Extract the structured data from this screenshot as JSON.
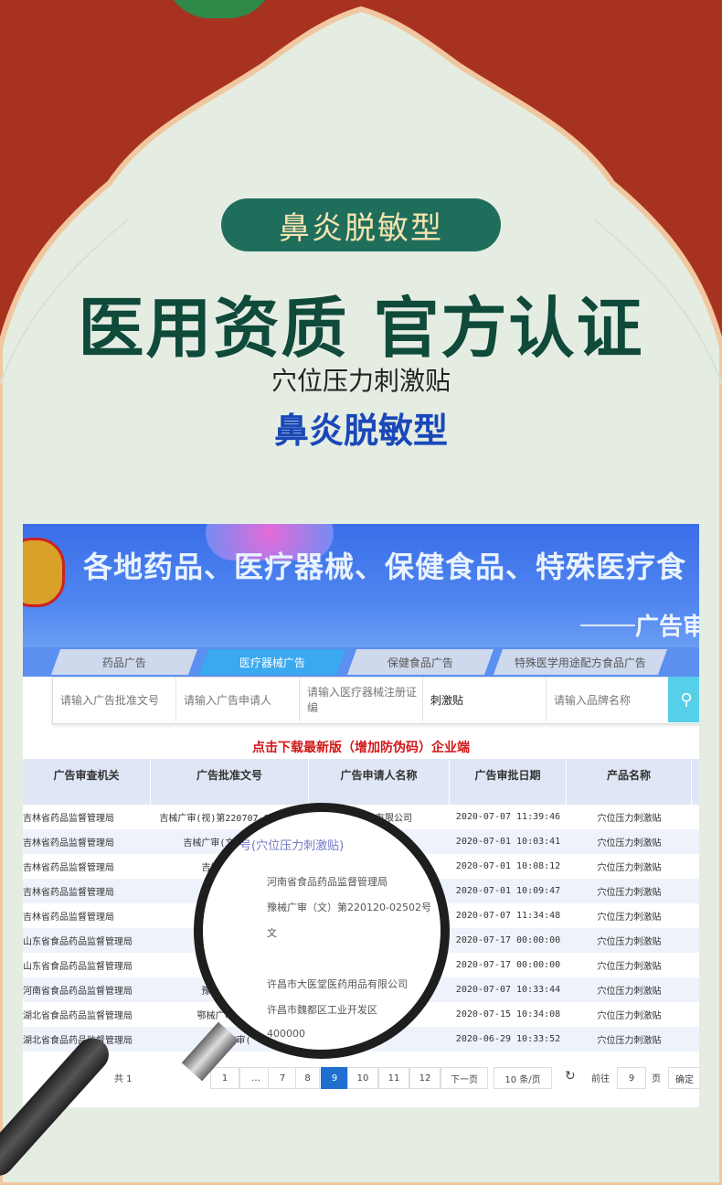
{
  "badge": "鼻炎脱敏型",
  "headline": "医用资质  官方认证",
  "subtitle": "穴位压力刺激贴",
  "subtitle_highlight": "鼻炎脱敏型",
  "site": {
    "banner_title": "各地药品、医疗器械、保健食品、特殊医疗食",
    "banner_sub": "广告审"
  },
  "tabs": [
    {
      "label": "药品广告"
    },
    {
      "label": "医疗器械广告"
    },
    {
      "label": "保健食品广告"
    },
    {
      "label": "特殊医学用途配方食品广告"
    }
  ],
  "search": {
    "approval_no_placeholder": "请输入广告批准文号",
    "applicant_placeholder": "请输入广告申请人",
    "reg_cert_placeholder": "请输入医疗器械注册证编",
    "keyword_value": "刺激贴",
    "brand_placeholder": "请输入品牌名称"
  },
  "download_text": "点击下载最新版（增加防伪码）企业端",
  "table": {
    "headers": [
      "广告审查机关",
      "广告批准文号",
      "广告申请人名称",
      "广告审批日期",
      "产品名称"
    ],
    "rows": [
      [
        "吉林省药品监督管理局",
        "吉械广审(视)第220707-00009号",
        "……药业有限公司",
        "2020-07-07 11:39:46",
        "穴位压力刺激贴"
      ],
      [
        "吉林省药品监督管理局",
        "吉械广审(文)第22062",
        "",
        "2020-07-01 10:03:41",
        "穴位压力刺激贴"
      ],
      [
        "吉林省药品监督管理局",
        "吉械广审(声)",
        "",
        "2020-07-01 10:08:12",
        "穴位压力刺激贴"
      ],
      [
        "吉林省药品监督管理局",
        "吉械广审",
        "",
        "2020-07-01 10:09:47",
        "穴位压力刺激贴"
      ],
      [
        "吉林省药品监督管理局",
        "吉械广审",
        "",
        "2020-07-07 11:34:48",
        "穴位压力刺激贴"
      ],
      [
        "山东省食品药品监督管理局",
        "鲁械广审(",
        "",
        "2020-07-17 00:00:00",
        "穴位压力刺激贴"
      ],
      [
        "山东省食品药品监督管理局",
        "鲁械广审(",
        "",
        "2020-07-17 00:00:00",
        "穴位压力刺激贴"
      ],
      [
        "河南省食品药品监督管理局",
        "豫械广审(文)",
        "",
        "2020-07-07 10:33:44",
        "穴位压力刺激贴"
      ],
      [
        "湖北省食品药品监督管理局",
        "鄂械广审(文)第",
        "",
        "2020-07-15 10:34:08",
        "穴位压力刺激贴"
      ],
      [
        "湖北省食品药品监督管理局",
        "鄂械广审(",
        "",
        "2020-06-29 10:33:52",
        "穴位压力刺激贴"
      ]
    ]
  },
  "pager": {
    "total_prefix": "共 1",
    "pages": [
      "1",
      "…",
      "7",
      "8",
      "9",
      "10",
      "11",
      "12"
    ],
    "current": "9",
    "next": "下一页",
    "per_page": "10 条/页",
    "goto_prefix": "前往",
    "goto_value": "9",
    "goto_suffix": "页",
    "confirm": "确定"
  },
  "lens": {
    "title": "号(穴位压力刺激贴)",
    "lines": [
      "河南省食品药品监督管理局",
      "豫械广审（文）第220120-02502号",
      "文",
      "",
      "许昌市大医堂医药用品有限公司",
      "许昌市魏都区工业开发区",
      "400000"
    ]
  }
}
